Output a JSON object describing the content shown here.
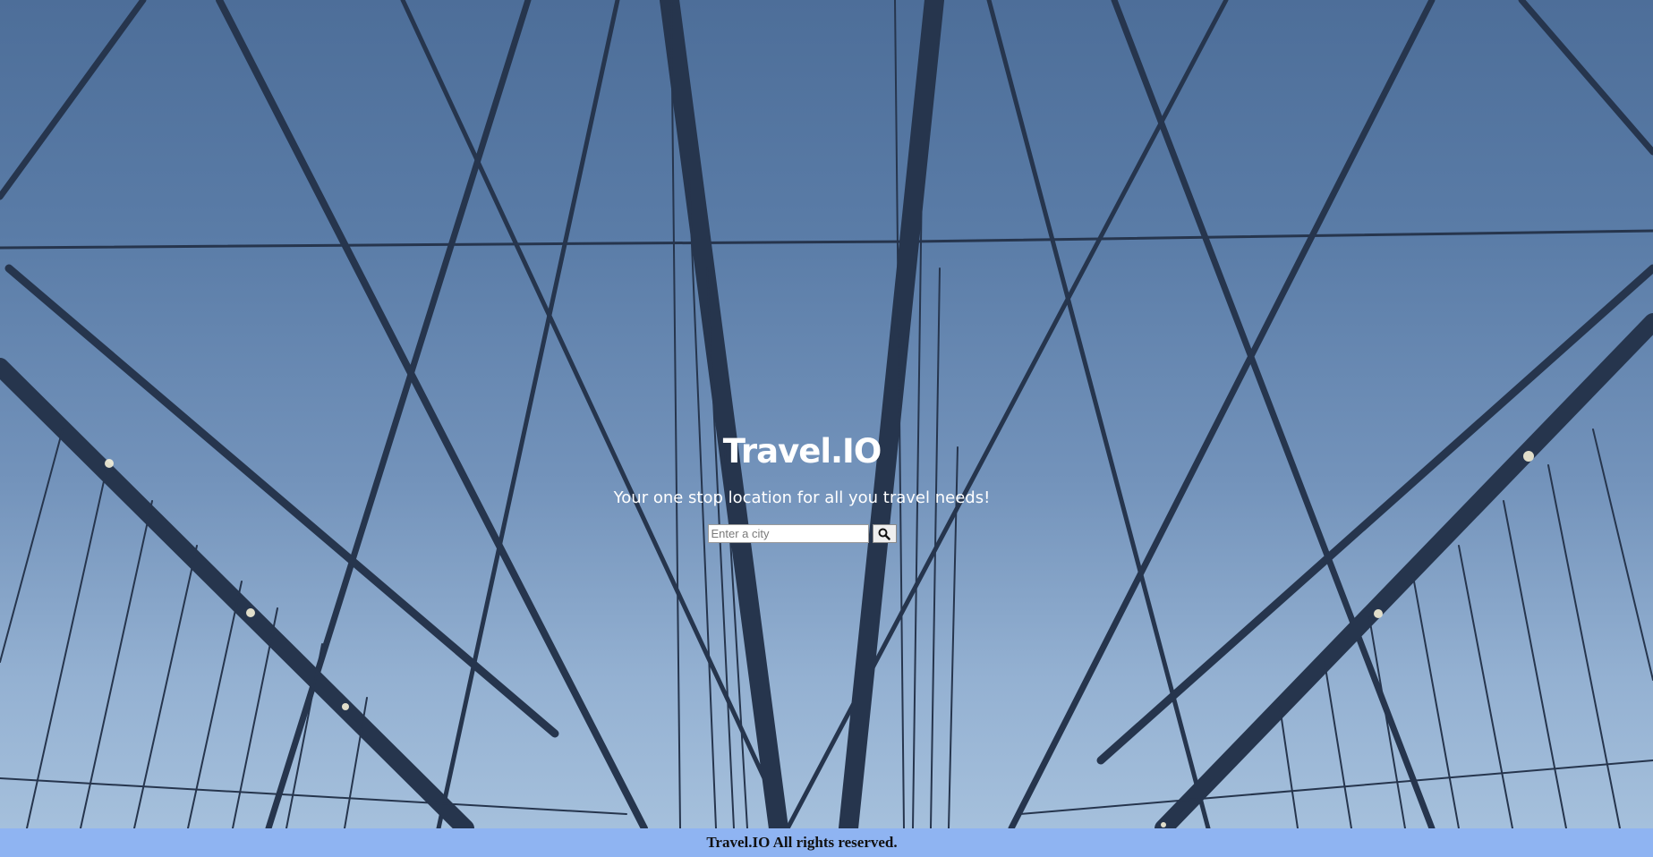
{
  "hero": {
    "brand_title": "Travel.IO",
    "tagline": "Your one stop location for all you travel needs!",
    "background_image": "suspension-bridge-cables-sky"
  },
  "search": {
    "placeholder": "Enter a city",
    "value": "",
    "button_icon": "search-icon"
  },
  "footer": {
    "text": "Travel.IO All rights reserved.",
    "background_color": "#8fb4f2"
  }
}
